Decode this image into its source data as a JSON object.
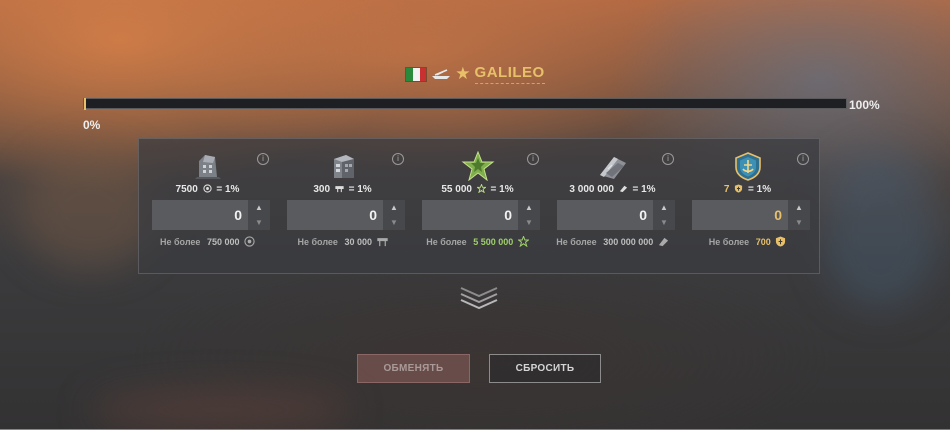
{
  "ship": {
    "name": "GALILEO",
    "nation": "Italy",
    "class_icon": "aircraft-carrier-icon",
    "tier_icon": "star-icon"
  },
  "progress": {
    "value": 0,
    "left_label": "0%",
    "right_label": "100%"
  },
  "resources": [
    {
      "name": "coal",
      "icon": "coal-icon",
      "rate_amount": "7500",
      "rate_suffix": "= 1%",
      "value": "0",
      "limit_label": "Не более",
      "limit_value": "750 000"
    },
    {
      "name": "steel",
      "icon": "steel-icon",
      "rate_amount": "300",
      "rate_suffix": "= 1%",
      "value": "0",
      "limit_label": "Не более",
      "limit_value": "30 000"
    },
    {
      "name": "free-xp",
      "icon": "free-xp-icon",
      "rate_amount": "55 000",
      "rate_suffix": "= 1%",
      "value": "0",
      "limit_label": "Не более",
      "limit_value": "5 500 000"
    },
    {
      "name": "credits",
      "icon": "credits-icon",
      "rate_amount": "3 000 000",
      "rate_suffix": "= 1%",
      "value": "0",
      "limit_label": "Не более",
      "limit_value": "300 000 000"
    },
    {
      "name": "doubloons",
      "icon": "doubloons-icon",
      "rate_amount": "7",
      "rate_suffix": "= 1%",
      "value": "0",
      "limit_label": "Не более",
      "limit_value": "700"
    }
  ],
  "buttons": {
    "exchange": "ОБМЕНЯТЬ",
    "reset": "СБРОСИТЬ"
  },
  "colors": {
    "accent_gold": "#e8c06a",
    "xp_green": "#9fcf6a"
  }
}
